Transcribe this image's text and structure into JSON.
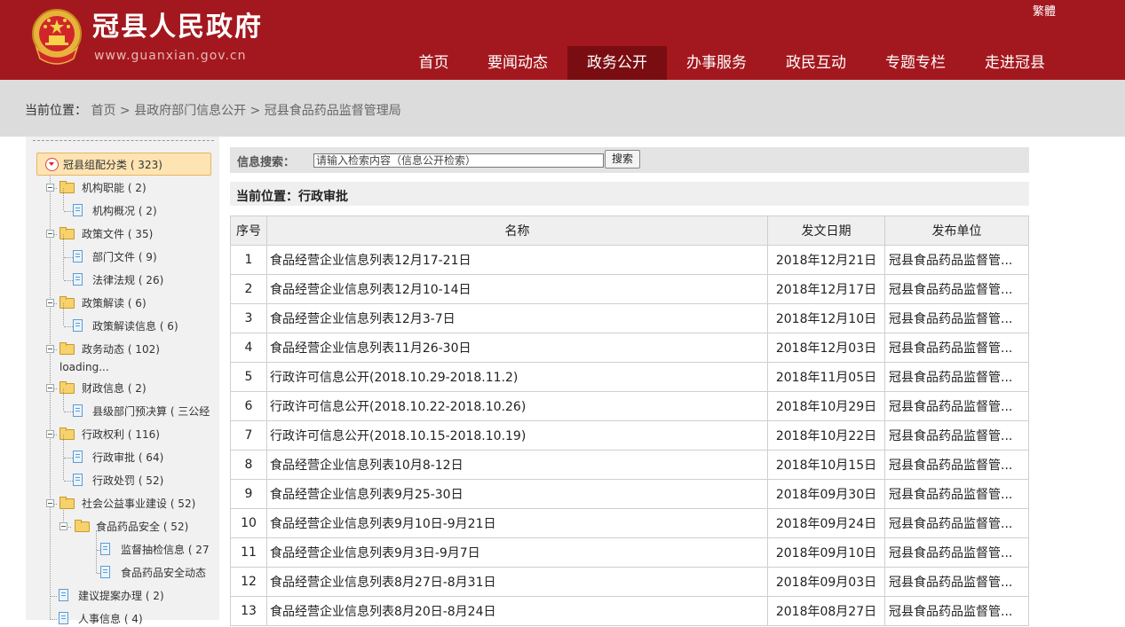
{
  "header": {
    "site_name": "冠县人民政府",
    "domain": "www.guanxian.gov.cn",
    "lang_toggle": "繁體"
  },
  "nav": [
    {
      "label": "首页",
      "active": false
    },
    {
      "label": "要闻动态",
      "active": false
    },
    {
      "label": "政务公开",
      "active": true
    },
    {
      "label": "办事服务",
      "active": false
    },
    {
      "label": "政民互动",
      "active": false
    },
    {
      "label": "专题专栏",
      "active": false
    },
    {
      "label": "走进冠县",
      "active": false
    }
  ],
  "breadcrumb": {
    "label": "当前位置：",
    "items": [
      "首页",
      "县政府部门信息公开",
      "冠县食品药品监督管理局"
    ],
    "separator": ">"
  },
  "sidebar": {
    "root": "冠县组配分类 ( 323)",
    "loading": "loading...",
    "nodes": [
      {
        "label": "机构职能 ( 2)",
        "type": "folder"
      },
      {
        "label": "机构概况 ( 2)",
        "type": "doc"
      },
      {
        "label": "政策文件 ( 35)",
        "type": "folder"
      },
      {
        "label": "部门文件 ( 9)",
        "type": "doc"
      },
      {
        "label": "法律法规 ( 26)",
        "type": "doc"
      },
      {
        "label": "政策解读 ( 6)",
        "type": "folder"
      },
      {
        "label": "政策解读信息 ( 6)",
        "type": "doc"
      },
      {
        "label": "政务动态 ( 102)",
        "type": "folder"
      },
      {
        "label": "财政信息 ( 2)",
        "type": "folder"
      },
      {
        "label": "县级部门预决算 ( 三公经",
        "type": "doc"
      },
      {
        "label": "行政权利 ( 116)",
        "type": "folder"
      },
      {
        "label": "行政审批 ( 64)",
        "type": "doc"
      },
      {
        "label": "行政处罚 ( 52)",
        "type": "doc"
      },
      {
        "label": "社会公益事业建设 ( 52)",
        "type": "folder"
      },
      {
        "label": "食品药品安全 ( 52)",
        "type": "folder"
      },
      {
        "label": "监督抽检信息 ( 27",
        "type": "doc"
      },
      {
        "label": "食品药品安全动态",
        "type": "doc"
      },
      {
        "label": "建议提案办理 ( 2)",
        "type": "doc"
      },
      {
        "label": "人事信息 ( 4)",
        "type": "doc"
      }
    ]
  },
  "search": {
    "label": "信息搜索：",
    "placeholder": "请输入检索内容（信息公开检索）",
    "button": "搜索"
  },
  "section": {
    "title": "当前位置：行政审批"
  },
  "table": {
    "headers": [
      "序号",
      "名称",
      "发文日期",
      "发布单位"
    ],
    "rows": [
      [
        "1",
        "食品经营企业信息列表12月17-21日",
        "2018年12月21日",
        "冠县食品药品监督管..."
      ],
      [
        "2",
        "食品经营企业信息列表12月10-14日",
        "2018年12月17日",
        "冠县食品药品监督管..."
      ],
      [
        "3",
        "食品经营企业信息列表12月3-7日",
        "2018年12月10日",
        "冠县食品药品监督管..."
      ],
      [
        "4",
        "食品经营企业信息列表11月26-30日",
        "2018年12月03日",
        "冠县食品药品监督管..."
      ],
      [
        "5",
        "行政许可信息公开(2018.10.29-2018.11.2)",
        "2018年11月05日",
        "冠县食品药品监督管..."
      ],
      [
        "6",
        "行政许可信息公开(2018.10.22-2018.10.26)",
        "2018年10月29日",
        "冠县食品药品监督管..."
      ],
      [
        "7",
        "行政许可信息公开(2018.10.15-2018.10.19)",
        "2018年10月22日",
        "冠县食品药品监督管..."
      ],
      [
        "8",
        "食品经营企业信息列表10月8-12日",
        "2018年10月15日",
        "冠县食品药品监督管..."
      ],
      [
        "9",
        "食品经营企业信息列表9月25-30日",
        "2018年09月30日",
        "冠县食品药品监督管..."
      ],
      [
        "10",
        "食品经营企业信息列表9月10日-9月21日",
        "2018年09月24日",
        "冠县食品药品监督管..."
      ],
      [
        "11",
        "食品经营企业信息列表9月3日-9月7日",
        "2018年09月10日",
        "冠县食品药品监督管..."
      ],
      [
        "12",
        "食品经营企业信息列表8月27日-8月31日",
        "2018年09月03日",
        "冠县食品药品监督管..."
      ],
      [
        "13",
        "食品经营企业信息列表8月20日-8月24日",
        "2018年08月27日",
        "冠县食品药品监督管..."
      ]
    ]
  },
  "colors": {
    "header_bg": "#a3181e",
    "nav_active_bg": "#7a0d12",
    "crumb_bg": "#dcdcdc",
    "sidebar_bg": "#f1f1f1"
  }
}
